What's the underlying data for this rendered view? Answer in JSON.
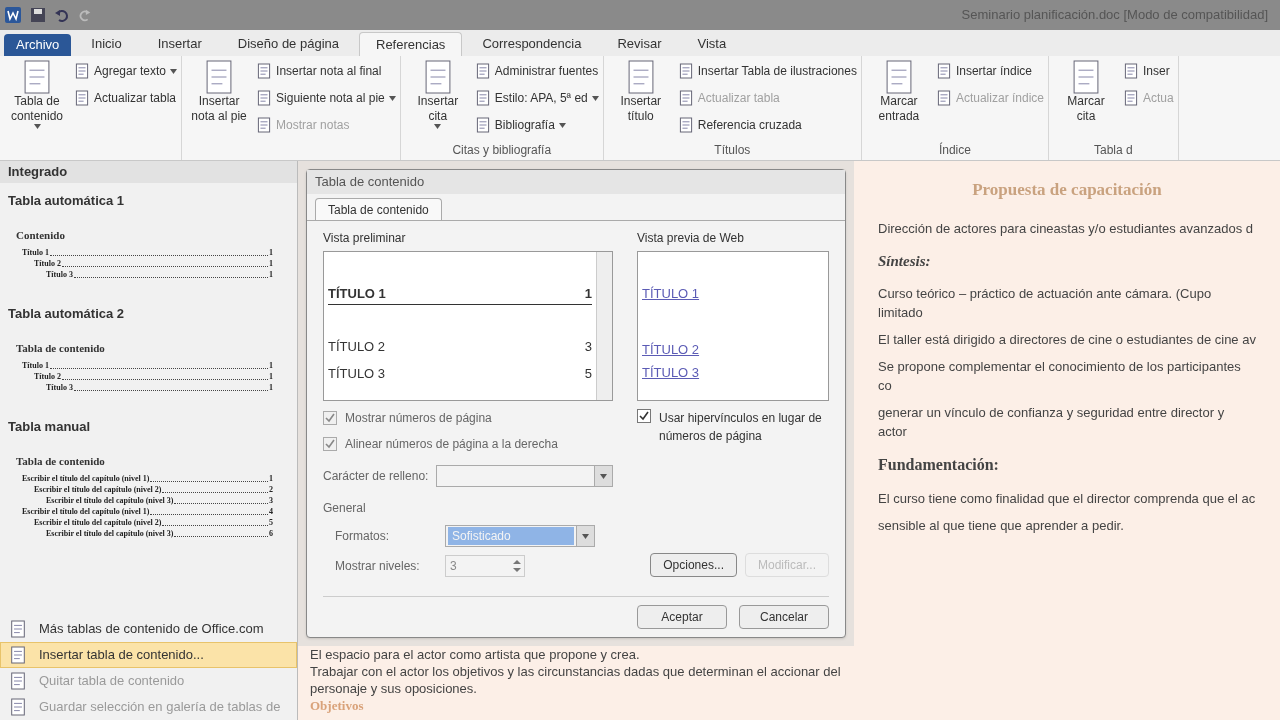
{
  "window": {
    "title": "Seminario planificación.doc [Modo de compatibilidad]"
  },
  "tabs": [
    {
      "label": "Archivo",
      "kind": "file",
      "selected": false
    },
    {
      "label": "Inicio",
      "kind": "tab",
      "selected": false
    },
    {
      "label": "Insertar",
      "kind": "tab",
      "selected": false
    },
    {
      "label": "Diseño de página",
      "kind": "tab",
      "selected": false
    },
    {
      "label": "Referencias",
      "kind": "tab",
      "selected": true
    },
    {
      "label": "Correspondencia",
      "kind": "tab",
      "selected": false
    },
    {
      "label": "Revisar",
      "kind": "tab",
      "selected": false
    },
    {
      "label": "Vista",
      "kind": "tab",
      "selected": false
    }
  ],
  "ribbon": {
    "groups": [
      {
        "items": [
          {
            "kind": "large",
            "label": "Tabla de contenido",
            "dropdown": true,
            "disabled": false
          },
          {
            "kind": "small",
            "label": "Agregar texto",
            "dropdown": true,
            "disabled": false
          },
          {
            "kind": "small",
            "label": "Actualizar tabla",
            "dropdown": false,
            "disabled": false
          }
        ]
      },
      {
        "items": [
          {
            "kind": "large",
            "label": "Insertar nota al pie",
            "dropdown": false,
            "disabled": false
          },
          {
            "kind": "small",
            "label": "Insertar nota al final",
            "dropdown": false,
            "disabled": false
          },
          {
            "kind": "small",
            "label": "Siguiente nota al pie",
            "dropdown": true,
            "disabled": false
          },
          {
            "kind": "small",
            "label": "Mostrar notas",
            "dropdown": false,
            "disabled": true
          }
        ]
      },
      {
        "label": "Citas y bibliografía",
        "items": [
          {
            "kind": "large",
            "label": "Insertar cita",
            "dropdown": true,
            "disabled": false
          },
          {
            "kind": "small",
            "label": "Administrar fuentes",
            "dropdown": false,
            "disabled": false
          },
          {
            "kind": "style",
            "label": "Estilo:",
            "value": "APA, 5ª ed",
            "dropdown": true,
            "disabled": false
          },
          {
            "kind": "small",
            "label": "Bibliografía",
            "dropdown": true,
            "disabled": false
          }
        ]
      },
      {
        "label": "Títulos",
        "items": [
          {
            "kind": "large",
            "label": "Insertar título",
            "dropdown": false,
            "disabled": false
          },
          {
            "kind": "small",
            "label": "Insertar Tabla de ilustraciones",
            "dropdown": false,
            "disabled": false
          },
          {
            "kind": "small",
            "label": "Actualizar tabla",
            "dropdown": false,
            "disabled": true
          },
          {
            "kind": "small",
            "label": "Referencia cruzada",
            "dropdown": false,
            "disabled": false
          }
        ]
      },
      {
        "label": "Índice",
        "items": [
          {
            "kind": "large",
            "label": "Marcar entrada",
            "dropdown": false,
            "disabled": false
          },
          {
            "kind": "small",
            "label": "Insertar índice",
            "dropdown": false,
            "disabled": false
          },
          {
            "kind": "small",
            "label": "Actualizar índice",
            "dropdown": false,
            "disabled": true
          }
        ]
      },
      {
        "label": "Tabla d",
        "items": [
          {
            "kind": "large",
            "label": "Marcar cita",
            "dropdown": false,
            "disabled": false
          },
          {
            "kind": "small",
            "label": "Inser",
            "dropdown": false,
            "disabled": false
          },
          {
            "kind": "small",
            "label": "Actua",
            "dropdown": false,
            "disabled": true
          }
        ]
      }
    ]
  },
  "toc_menu": {
    "header": "Integrado",
    "gallery": [
      {
        "title": "Tabla automática 1",
        "heading": "Contenido",
        "entries": [
          {
            "text": "Título 1",
            "page": "1",
            "children": [
              {
                "text": "Título 2",
                "page": "1",
                "children": [
                  {
                    "text": "Título 3",
                    "page": "1"
                  }
                ]
              }
            ]
          }
        ]
      },
      {
        "title": "Tabla automática 2",
        "heading": "Tabla de contenido",
        "entries": [
          {
            "text": "Título 1",
            "page": "1",
            "children": [
              {
                "text": "Título 2",
                "page": "1",
                "children": [
                  {
                    "text": "Título 3",
                    "page": "1"
                  }
                ]
              }
            ]
          }
        ]
      },
      {
        "title": "Tabla manual",
        "heading": "Tabla de contenido",
        "entries": [
          {
            "text": "Escribir el título del capítulo (nivel 1)",
            "page": "1",
            "children": [
              {
                "text": "Escribir el título del capítulo (nivel 2)",
                "page": "2",
                "children": [
                  {
                    "text": "Escribir el título del capítulo (nivel 3)",
                    "page": "3"
                  }
                ]
              }
            ]
          },
          {
            "text": "Escribir el título del capítulo (nivel 1)",
            "page": "4",
            "children": [
              {
                "text": "Escribir el título del capítulo (nivel 2)",
                "page": "5",
                "children": [
                  {
                    "text": "Escribir el título del capítulo (nivel 3)",
                    "page": "6"
                  }
                ]
              }
            ]
          }
        ]
      }
    ],
    "commands": [
      {
        "label": "Más tablas de contenido de Office.com",
        "selected": false,
        "disabled": false
      },
      {
        "label": "Insertar tabla de contenido...",
        "selected": true,
        "disabled": false
      },
      {
        "label": "Quitar tabla de contenido",
        "selected": false,
        "disabled": true
      },
      {
        "label": "Guardar selección en galería de tablas de",
        "selected": false,
        "disabled": true
      }
    ]
  },
  "dialog": {
    "title": "Tabla de contenido",
    "tabs": [
      {
        "label": "Tabla de contenido",
        "selected": true
      }
    ],
    "print_preview": {
      "label": "Vista preliminar",
      "entries": [
        {
          "text": "TÍTULO 1",
          "page": "1"
        },
        {
          "text": "TÍTULO 2",
          "page": "3"
        },
        {
          "text": "TÍTULO 3",
          "page": "5"
        }
      ]
    },
    "options": [
      {
        "label": "Mostrar números de página",
        "checked": true
      },
      {
        "label": "Alinear números de página a la derecha",
        "checked": true
      }
    ],
    "leader": {
      "label": "Carácter de relleno:"
    },
    "web_preview": {
      "label": "Vista previa de Web",
      "links": [
        "TÍTULO 1",
        "TÍTULO 2",
        "TÍTULO 3"
      ]
    },
    "hyperlinks": {
      "label": "Usar hipervínculos en lugar de números de página",
      "checked": true
    },
    "general": {
      "label": "General",
      "formats": {
        "label": "Formatos:",
        "value": "Sofisticado"
      },
      "levels": {
        "label": "Mostrar niveles:",
        "value": "3"
      }
    },
    "side_buttons": [
      {
        "label": "Opciones...",
        "disabled": false
      },
      {
        "label": "Modificar...",
        "disabled": true
      }
    ],
    "buttons": [
      {
        "label": "Aceptar",
        "disabled": false
      },
      {
        "label": "Cancelar",
        "disabled": false
      }
    ]
  },
  "document": {
    "blocks": [
      {
        "kind": "title",
        "text": "Propuesta de capacitación"
      },
      {
        "kind": "text",
        "text": "Dirección de actores para cineastas y/o estudiantes avanzados d"
      },
      {
        "kind": "italic-heading",
        "text": "Síntesis:"
      },
      {
        "kind": "text",
        "text": "Curso teórico – práctico de actuación ante cámara. (Cupo limitado"
      },
      {
        "kind": "text",
        "text": "El taller está dirigido a directores de cine o estudiantes de cine av"
      },
      {
        "kind": "text",
        "text": "Se propone complementar el conocimiento de los participantes co"
      },
      {
        "kind": "text",
        "text": "generar un vínculo de confianza y seguridad entre director y actor"
      },
      {
        "kind": "heading",
        "text": "Fundamentación:"
      },
      {
        "kind": "text",
        "text": "El curso tiene como finalidad que el director comprenda que el ac"
      },
      {
        "kind": "text",
        "text": "sensible al que tiene que aprender a pedir."
      }
    ],
    "lower_blocks": [
      {
        "kind": "text",
        "text": "El espacio para el actor como artista que propone y crea."
      },
      {
        "kind": "text",
        "text": "Trabajar con el actor los objetivos y las circunstancias dadas que determinan el accionar del"
      },
      {
        "kind": "text",
        "text": "personaje y sus oposiciones."
      },
      {
        "kind": "subheading",
        "text": "Objetivos"
      }
    ]
  }
}
